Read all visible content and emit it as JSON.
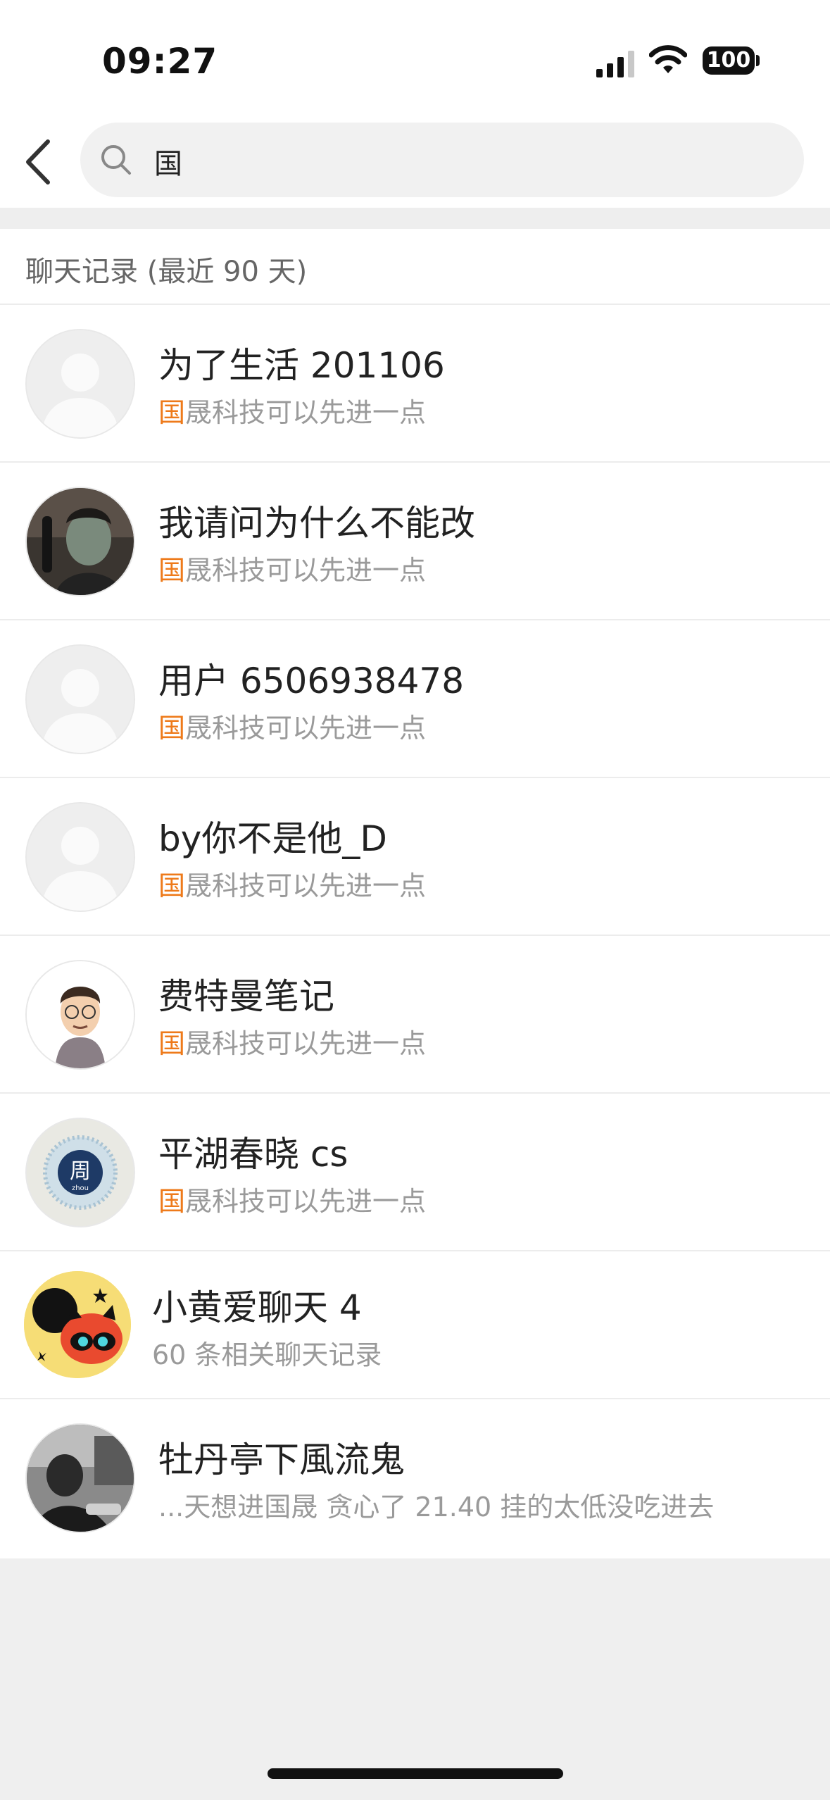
{
  "status": {
    "time": "09:27",
    "battery": "100"
  },
  "search": {
    "query": "国"
  },
  "section": {
    "title": "聊天记录 (最近 90 天)"
  },
  "results": [
    {
      "name": "为了生活 201106",
      "highlight": "国",
      "snippet": "晟科技可以先进一点",
      "avatar": "default-avatar"
    },
    {
      "name": "我请问为什么不能改",
      "highlight": "国",
      "snippet": "晟科技可以先进一点",
      "avatar": "photo-avatar"
    },
    {
      "name": "用户 6506938478",
      "highlight": "国",
      "snippet": "晟科技可以先进一点",
      "avatar": "default-avatar"
    },
    {
      "name": "by你不是他_D",
      "highlight": "国",
      "snippet": "晟科技可以先进一点",
      "avatar": "default-avatar"
    },
    {
      "name": "费特曼笔记",
      "highlight": "国",
      "snippet": "晟科技可以先进一点",
      "avatar": "cartoon-avatar"
    },
    {
      "name": "平湖春晓 cs",
      "highlight": "国",
      "snippet": "晟科技可以先进一点",
      "avatar": "seal-avatar",
      "seal_char": "周",
      "seal_sub": "zhou"
    },
    {
      "name": "小黄爱聊天 4",
      "highlight": "",
      "snippet": "60 条相关聊天记录",
      "avatar": "yellow-cat-avatar"
    },
    {
      "name": "牡丹亭下風流鬼",
      "highlight": "",
      "snippet": "...天想进国晟 贪心了 21.40 挂的太低没吃进去",
      "avatar": "bw-photo-avatar"
    }
  ]
}
